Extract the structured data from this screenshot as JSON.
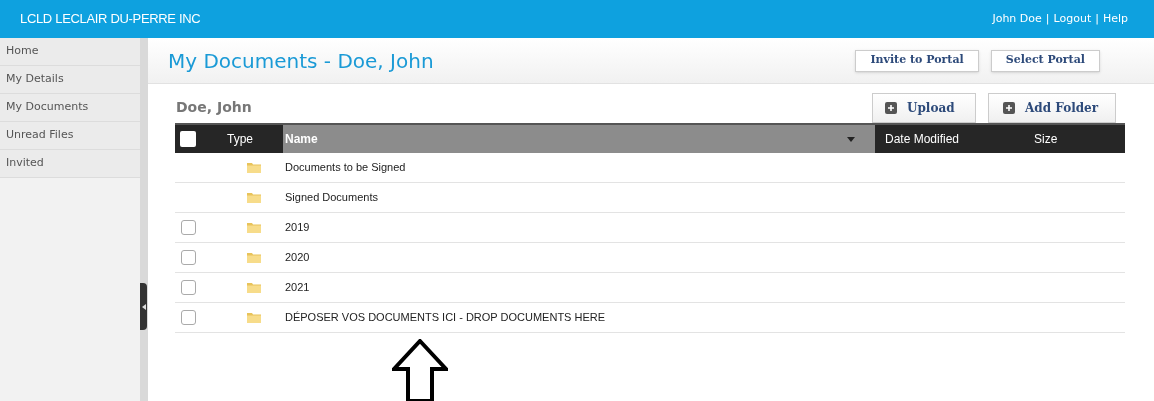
{
  "brand": "LCLD LECLAIR DU-PERRE INC",
  "user_menu": {
    "items": [
      "John Doe",
      "Logout",
      "Help"
    ],
    "separators": [
      "|",
      "|"
    ]
  },
  "sidebar": {
    "items": [
      "Home",
      "My Details",
      "My Documents",
      "Unread Files",
      "Invited"
    ]
  },
  "page_title": "My Documents - Doe, John",
  "header_buttons": [
    "Invite to Portal",
    "Select Portal"
  ],
  "breadcrumb": "Doe, John",
  "action_buttons": [
    "Upload",
    "Add Folder"
  ],
  "table": {
    "select_all_checked": false,
    "columns": [
      {
        "label": "Type",
        "sorted": false
      },
      {
        "label": "Name",
        "sorted": true
      },
      {
        "label": "Date Modified",
        "sorted": false
      },
      {
        "label": "Size",
        "sorted": false
      }
    ],
    "rows": [
      {
        "kind": "folder",
        "name": "Documents to be Signed",
        "selectable": false
      },
      {
        "kind": "folder",
        "name": "Signed Documents",
        "selectable": false
      },
      {
        "kind": "folder",
        "name": "2019",
        "selectable": true,
        "checked": false
      },
      {
        "kind": "folder",
        "name": "2020",
        "selectable": true,
        "checked": false
      },
      {
        "kind": "folder",
        "name": "2021",
        "selectable": true,
        "checked": false
      },
      {
        "kind": "folder",
        "name": "DÉPOSER VOS DOCUMENTS ICI - DROP DOCUMENTS HERE",
        "selectable": true,
        "checked": false
      }
    ]
  },
  "annotation": {
    "kind": "up-arrow"
  }
}
